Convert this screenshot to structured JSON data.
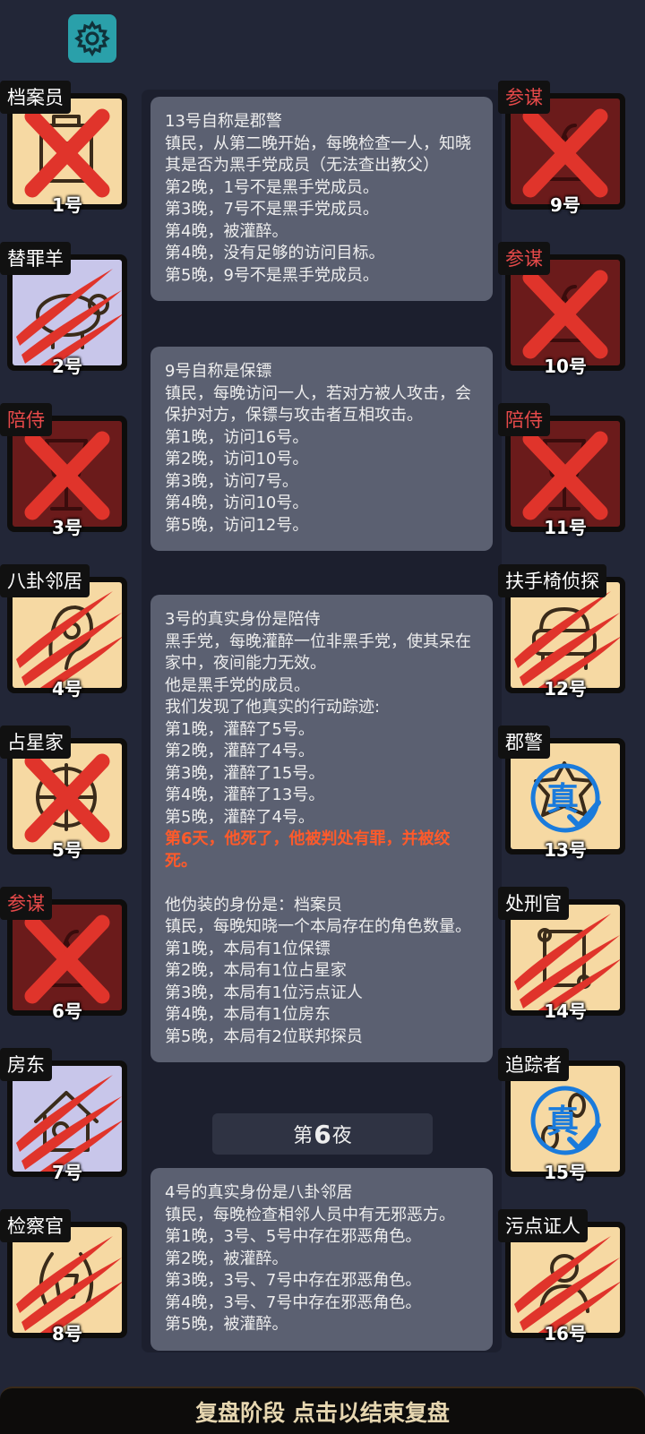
{
  "settings": {
    "icon": "gear-icon"
  },
  "left_players": [
    {
      "role": "档案员",
      "number": "1号",
      "faction": "town",
      "tag_color": "white",
      "status": "eliminated-x",
      "icon": "archive-icon"
    },
    {
      "role": "替罪羊",
      "number": "2号",
      "faction": "neutral",
      "tag_color": "white",
      "status": "claw-marks",
      "icon": "sheep-icon"
    },
    {
      "role": "陪侍",
      "number": "3号",
      "faction": "mafia",
      "tag_color": "red",
      "status": "eliminated-x",
      "icon": "wine-glass-icon"
    },
    {
      "role": "八卦邻居",
      "number": "4号",
      "faction": "town",
      "tag_color": "white",
      "status": "claw-marks",
      "icon": "ear-icon"
    },
    {
      "role": "占星家",
      "number": "5号",
      "faction": "town",
      "tag_color": "white",
      "status": "eliminated-x",
      "icon": "astrolabe-icon"
    },
    {
      "role": "参谋",
      "number": "6号",
      "faction": "mafia",
      "tag_color": "red",
      "status": "eliminated-x",
      "icon": "strategy-icon"
    },
    {
      "role": "房东",
      "number": "7号",
      "faction": "neutral",
      "tag_color": "white",
      "status": "claw-marks",
      "icon": "house-icon"
    },
    {
      "role": "检察官",
      "number": "8号",
      "faction": "town",
      "tag_color": "white",
      "status": "claw-marks",
      "icon": "laurel-icon"
    }
  ],
  "right_players": [
    {
      "role": "参谋",
      "number": "9号",
      "faction": "mafia",
      "tag_color": "red",
      "status": "eliminated-x",
      "icon": "strategy-icon"
    },
    {
      "role": "参谋",
      "number": "10号",
      "faction": "mafia",
      "tag_color": "red",
      "status": "eliminated-x",
      "icon": "strategy-icon"
    },
    {
      "role": "陪侍",
      "number": "11号",
      "faction": "mafia",
      "tag_color": "red",
      "status": "eliminated-x",
      "icon": "wine-glass-icon"
    },
    {
      "role": "扶手椅侦探",
      "number": "12号",
      "faction": "town",
      "tag_color": "white",
      "status": "claw-marks",
      "icon": "armchair-icon"
    },
    {
      "role": "郡警",
      "number": "13号",
      "faction": "town",
      "tag_color": "white",
      "status": "verified",
      "icon": "sheriff-badge-icon",
      "stamp": "真"
    },
    {
      "role": "处刑官",
      "number": "14号",
      "faction": "town",
      "tag_color": "white",
      "status": "claw-marks",
      "icon": "scroll-icon"
    },
    {
      "role": "追踪者",
      "number": "15号",
      "faction": "town",
      "tag_color": "white",
      "status": "verified",
      "icon": "footprints-icon",
      "stamp": "真"
    },
    {
      "role": "污点证人",
      "number": "16号",
      "faction": "town",
      "tag_color": "white",
      "status": "claw-marks",
      "icon": "witness-icon"
    }
  ],
  "log_cards": [
    {
      "lines": [
        {
          "text": "13号自称是郡警"
        },
        {
          "text": "镇民，从第二晚开始，每晚检查一人，知晓其是否为黑手党成员（无法查出教父）"
        },
        {
          "text": "第2晚，1号不是黑手党成员。"
        },
        {
          "text": "第3晚，7号不是黑手党成员。"
        },
        {
          "text": "第4晚，被灌醉。"
        },
        {
          "text": "第4晚，没有足够的访问目标。"
        },
        {
          "text": "第5晚，9号不是黑手党成员。"
        }
      ]
    },
    {
      "lines": [
        {
          "text": "9号自称是保镖"
        },
        {
          "text": "镇民，每晚访问一人，若对方被人攻击，会保护对方，保镖与攻击者互相攻击。"
        },
        {
          "text": "第1晚，访问16号。"
        },
        {
          "text": "第2晚，访问10号。"
        },
        {
          "text": "第3晚，访问7号。"
        },
        {
          "text": "第4晚，访问10号。"
        },
        {
          "text": "第5晚，访问12号。"
        }
      ]
    },
    {
      "lines": [
        {
          "text": "3号的真实身份是陪侍"
        },
        {
          "text": "黑手党，每晚灌醉一位非黑手党，使其呆在家中，夜间能力无效。"
        },
        {
          "text": "他是黑手党的成员。"
        },
        {
          "text": "我们发现了他真实的行动踪迹:"
        },
        {
          "text": "第1晚，灌醉了5号。"
        },
        {
          "text": "第2晚，灌醉了4号。"
        },
        {
          "text": "第3晚，灌醉了15号。"
        },
        {
          "text": "第4晚，灌醉了13号。"
        },
        {
          "text": "第5晚，灌醉了4号。"
        },
        {
          "text": "第6天，他死了，他被判处有罪，并被绞死。",
          "alert": true
        },
        {
          "text": " "
        },
        {
          "text": "他伪装的身份是：档案员"
        },
        {
          "text": "镇民，每晚知晓一个本局存在的角色数量。"
        },
        {
          "text": "第1晚，本局有1位保镖"
        },
        {
          "text": "第2晚，本局有1位占星家"
        },
        {
          "text": "第3晚，本局有1位污点证人"
        },
        {
          "text": "第4晚，本局有1位房东"
        },
        {
          "text": "第5晚，本局有2位联邦探员"
        }
      ]
    },
    {
      "lines": [
        {
          "text": "4号的真实身份是八卦邻居"
        },
        {
          "text": "镇民，每晚检查相邻人员中有无邪恶方。"
        },
        {
          "text": "第1晚，3号、5号中存在邪恶角色。"
        },
        {
          "text": "第2晚，被灌醉。"
        },
        {
          "text": "第3晚，3号、7号中存在邪恶角色。"
        },
        {
          "text": "第4晚，3号、7号中存在邪恶角色。"
        },
        {
          "text": "第5晚，被灌醉。"
        }
      ]
    }
  ],
  "night_banner": {
    "prefix": "第",
    "number": "6",
    "suffix": "夜"
  },
  "bottom_bar": {
    "label": "复盘阶段 点击以结束复盘"
  },
  "colors": {
    "background": "#222637",
    "town_card": "#f6d9a3",
    "mafia_card": "#6b1b1b",
    "neutral_card": "#c8c6ea",
    "mark_red": "#e0342b",
    "stamp_blue": "#1a7bdc",
    "alert_text": "#ff5a2a",
    "settings_teal": "#2aa0aa"
  }
}
